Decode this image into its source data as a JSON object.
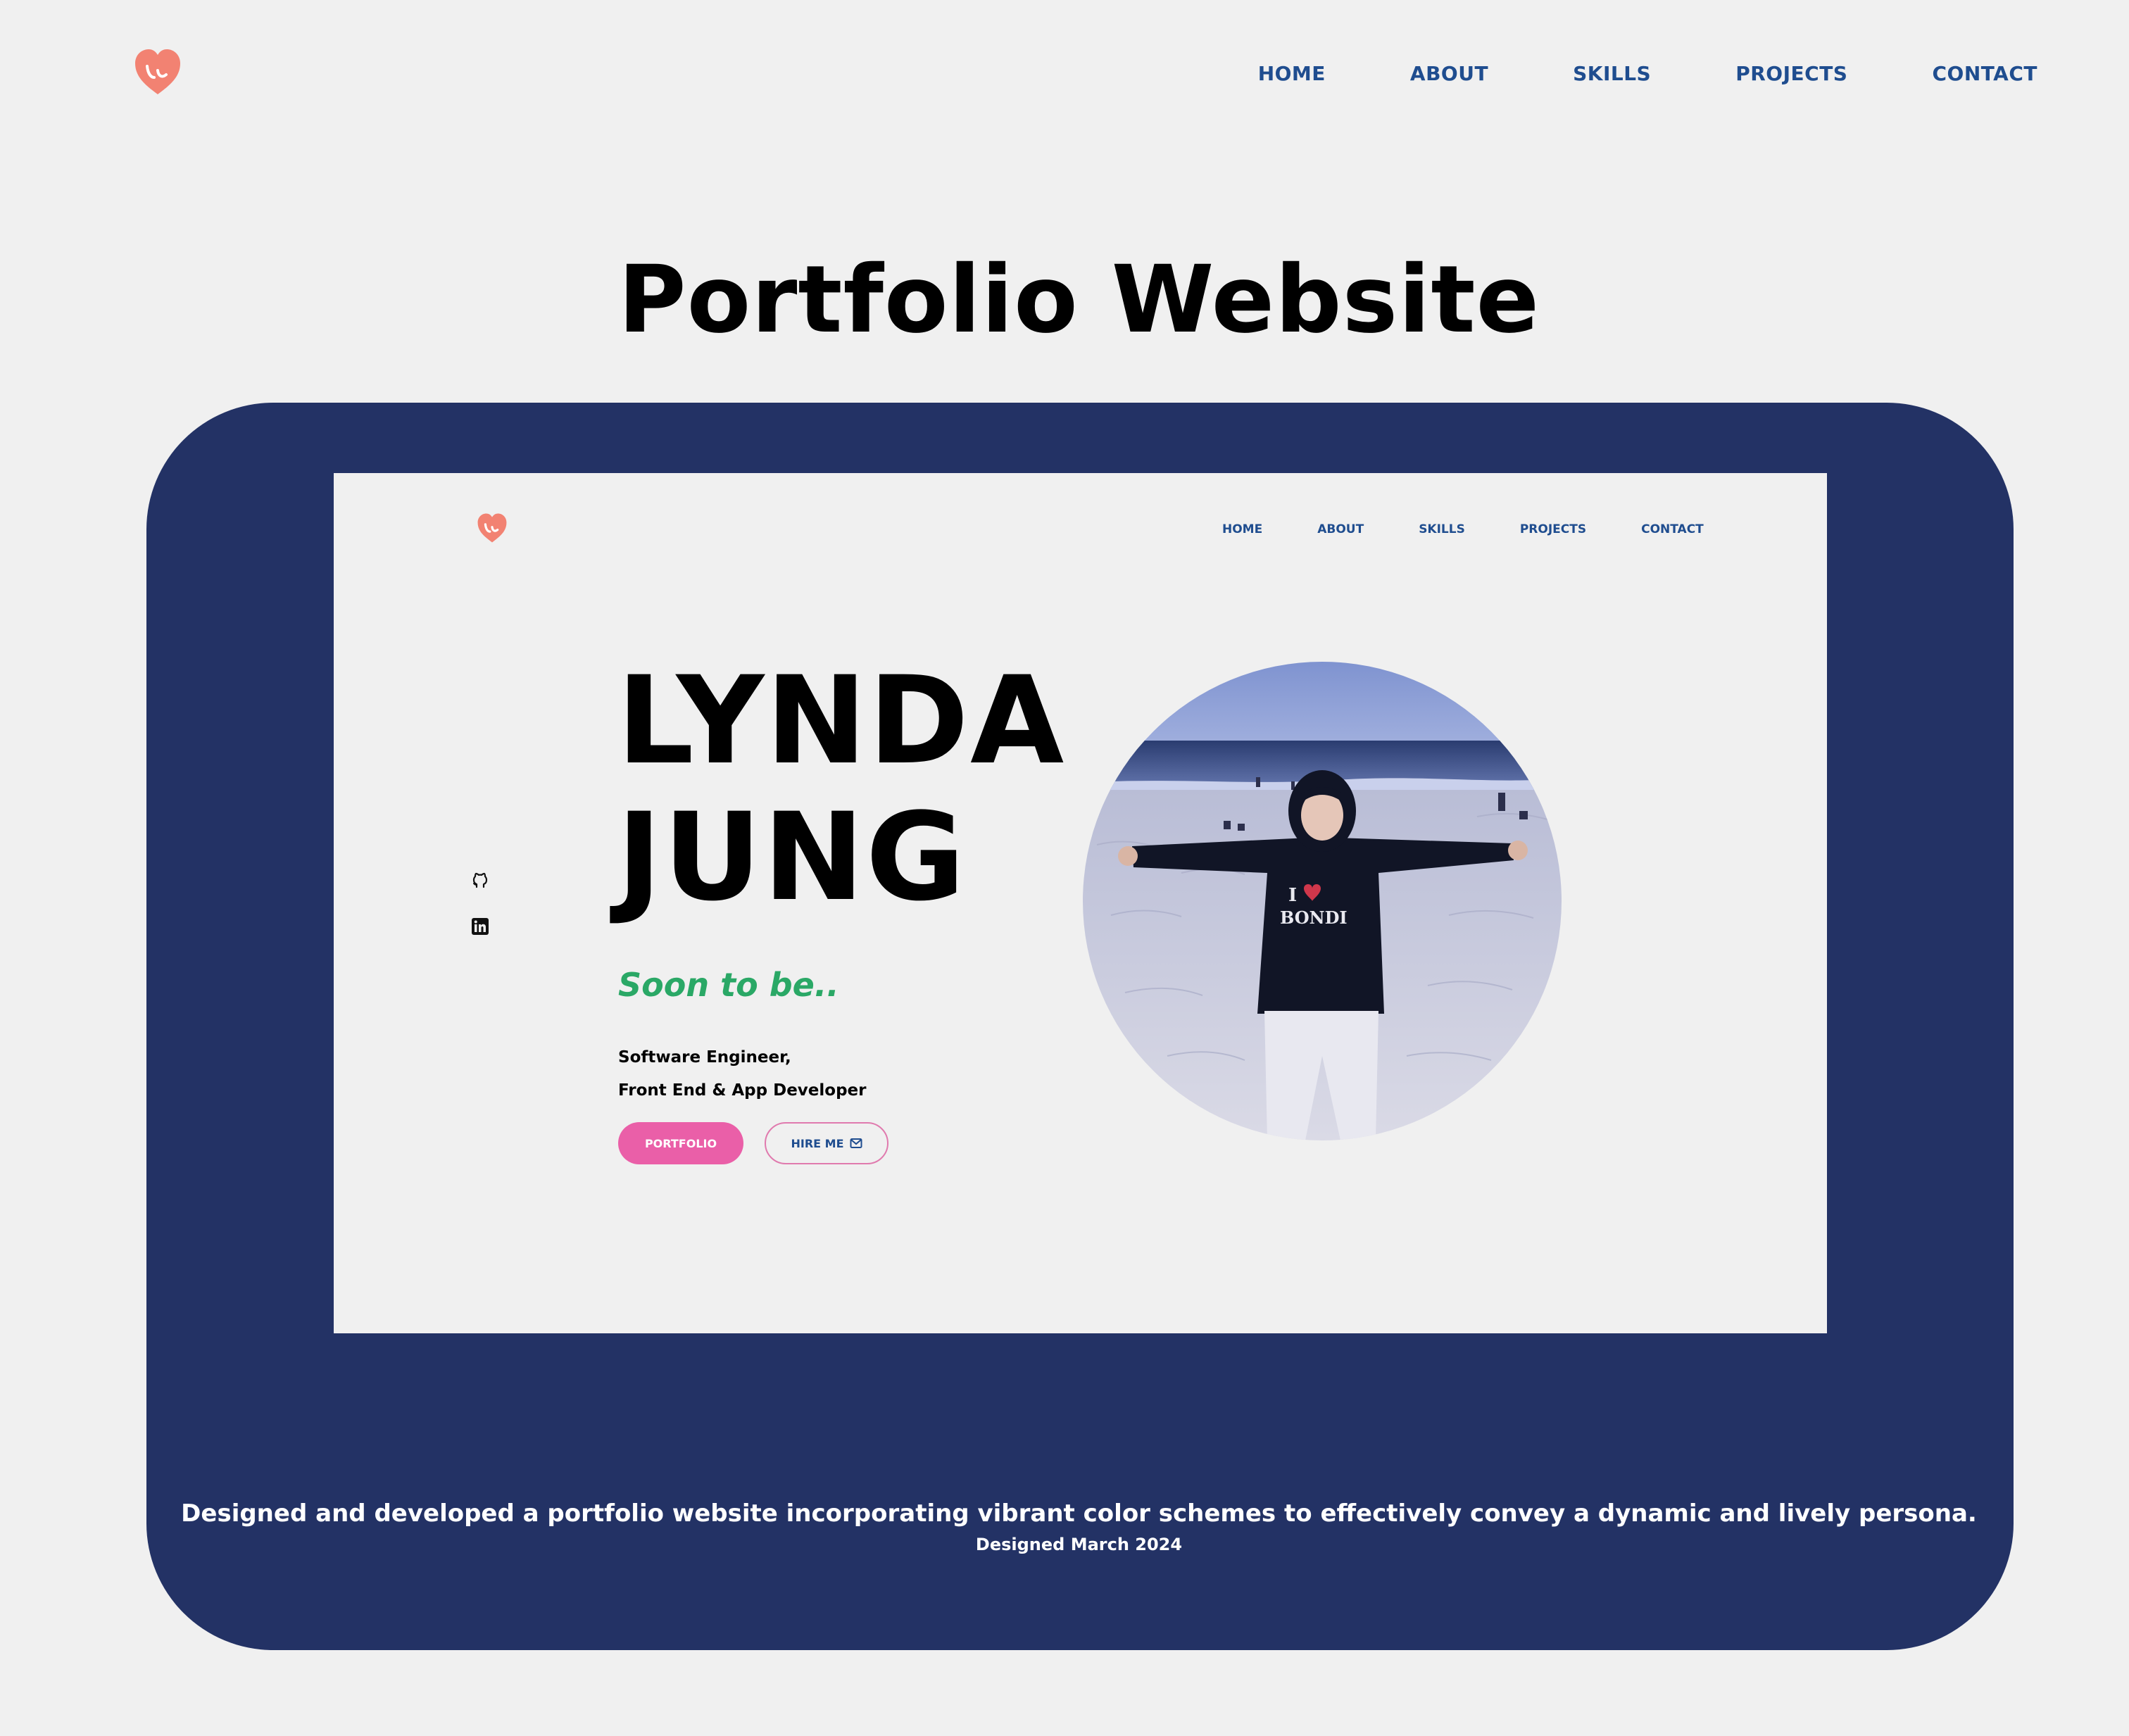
{
  "header": {
    "logo_icon": "heart-logo-icon",
    "nav": [
      "HOME",
      "ABOUT",
      "SKILLS",
      "PROJECTS",
      "CONTACT"
    ]
  },
  "page_title": "Portfolio Website",
  "preview": {
    "nav": [
      "HOME",
      "ABOUT",
      "SKILLS",
      "PROJECTS",
      "CONTACT"
    ],
    "social_icons": [
      "github-icon",
      "linkedin-icon"
    ],
    "name_line1": "LYNDA",
    "name_line2": "JUNG",
    "tagline": "Soon to be..",
    "role_line1": "Software Engineer,",
    "role_line2": "Front End & App Developer",
    "portfolio_button": "PORTFOLIO",
    "hire_button": "HIRE ME",
    "hire_icon": "mail-icon"
  },
  "caption": "Designed and developed a portfolio website incorporating vibrant color schemes to effectively convey a dynamic and lively persona.",
  "designed_date": "Designed March 2024",
  "colors": {
    "background": "#f0f0f0",
    "card": "#233265",
    "nav_text": "#1f4d8f",
    "logo": "#f08070",
    "tagline": "#2aa866",
    "portfolio_button": "#ea5fa8"
  }
}
